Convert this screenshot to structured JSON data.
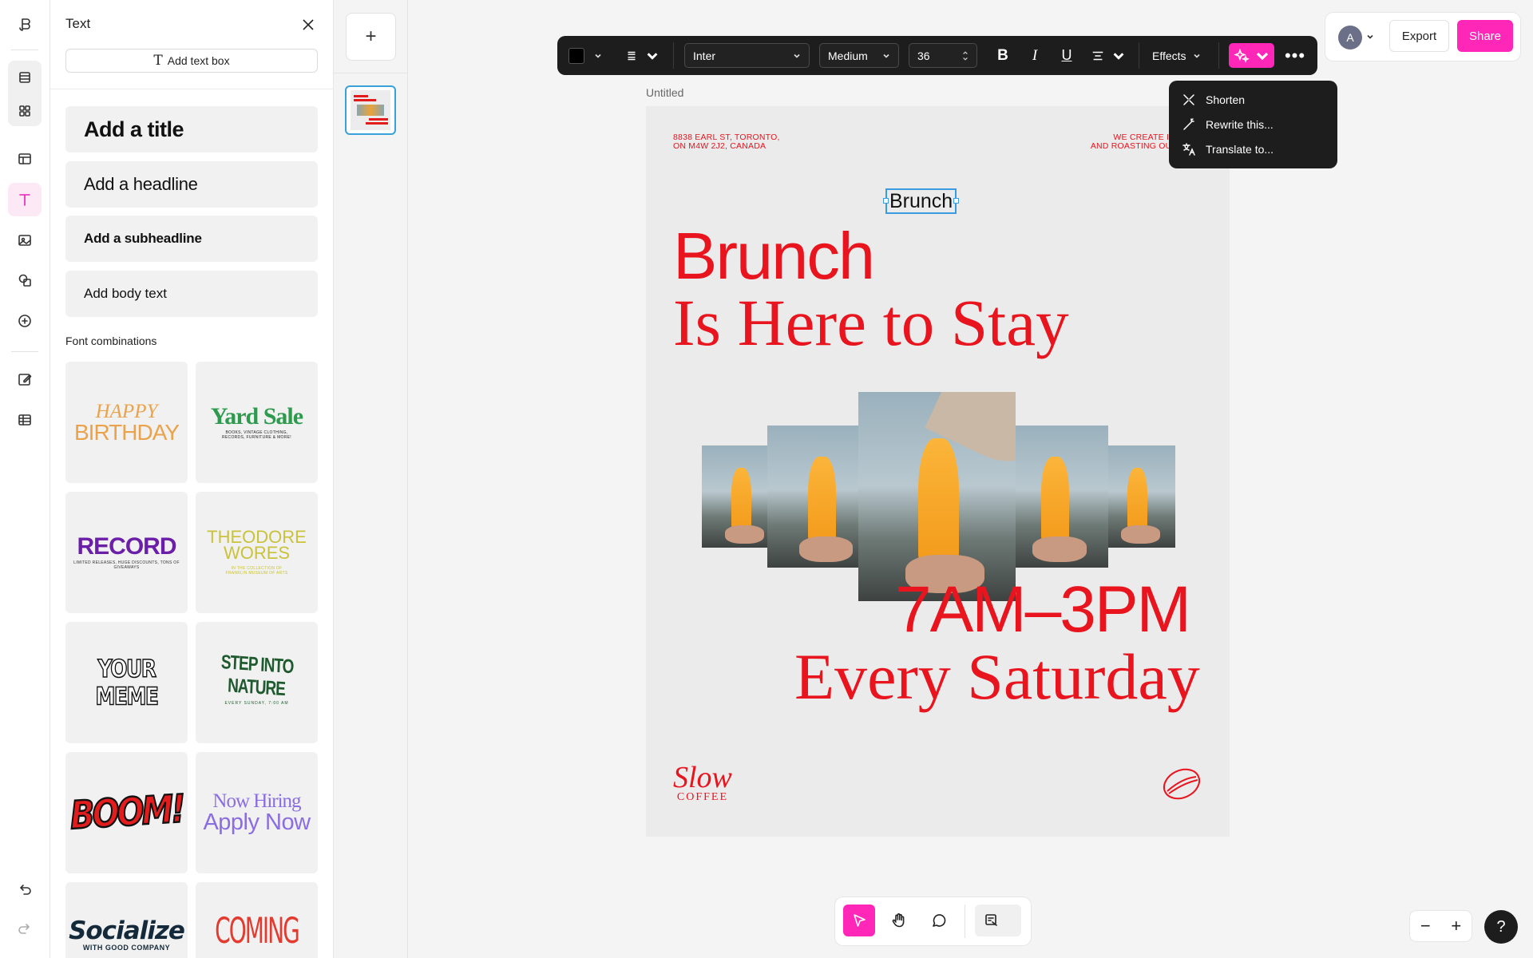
{
  "panel": {
    "title": "Text",
    "add_text_box": "Add text box",
    "styles": {
      "title": "Add a title",
      "headline": "Add a headline",
      "subheadline": "Add a subheadline",
      "body": "Add body text"
    },
    "font_combinations_label": "Font combinations",
    "combos": [
      {
        "line1": "HAPPY",
        "line2": "BIRTHDAY"
      },
      {
        "line1": "Yard Sale",
        "line2": "BOOKS, VINTAGE CLOTHING, RECORDS, FURNITURE & MORE!"
      },
      {
        "line1": "RECORD",
        "line2": "LIMITED RELEASES, HUGE DISCOUNTS, TONS OF GIVEAWAYS"
      },
      {
        "line1": "THEODORE",
        "line2": "WORES",
        "line3": "IN THE COLLECTION OF FRANKLIN MUSEUM OF ARTS"
      },
      {
        "line1": "YOUR MEME"
      },
      {
        "line1": "STEP INTO NATURE",
        "line2": "EVERY SUNDAY, 7:00 AM"
      },
      {
        "line1": "BOOM!"
      },
      {
        "line1": "Now Hiring",
        "line2": "Apply Now"
      },
      {
        "line1": "Socialize",
        "line2": "WITH GOOD COMPANY"
      },
      {
        "line1": "COMING SOON"
      }
    ]
  },
  "toolbar": {
    "font_family": "Inter",
    "font_weight": "Medium",
    "font_size": "36",
    "bold": "B",
    "italic": "I",
    "underline": "U",
    "effects": "Effects"
  },
  "ai_menu": {
    "items": [
      "Shorten",
      "Rewrite this...",
      "Translate to..."
    ]
  },
  "header": {
    "avatar_initial": "A",
    "export": "Export",
    "share": "Share"
  },
  "document": {
    "name": "Untitled"
  },
  "poster": {
    "address_left": [
      "8838 EARL ST, TORONTO,",
      "ON M4W 2J2, CANADA"
    ],
    "address_right": [
      "WE CREATE INVITING CAFÉ",
      "AND ROASTING OUTSTANDING C"
    ],
    "selected_text": "Brunch",
    "headline1": "Brunch",
    "headline2": "Is Here to Stay",
    "time": "7AM–3PM",
    "day": "Every Saturday",
    "logo_main": "Slow",
    "logo_sub": "COFFEE",
    "color": "#e8141e"
  },
  "zoom": {
    "minus": "−",
    "plus": "+"
  },
  "help": "?",
  "colors": {
    "accent": "#ff27b8",
    "selection": "#3a9be0",
    "toolbar_bg": "#1d1d1d"
  }
}
